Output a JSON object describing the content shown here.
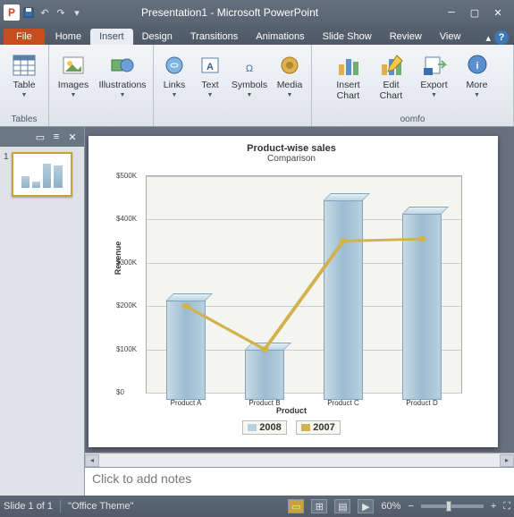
{
  "titlebar": {
    "logo_letter": "P",
    "title": "Presentation1 - Microsoft PowerPoint"
  },
  "tabs": {
    "file": "File",
    "items": [
      "Home",
      "Insert",
      "Design",
      "Transitions",
      "Animations",
      "Slide Show",
      "Review",
      "View"
    ],
    "active_index": 1
  },
  "ribbon": {
    "groups": [
      {
        "label": "Tables",
        "buttons": [
          {
            "name": "table",
            "label": "Table",
            "icon": "table"
          }
        ]
      },
      {
        "label": "",
        "buttons": [
          {
            "name": "images",
            "label": "Images",
            "icon": "image"
          },
          {
            "name": "illustrations",
            "label": "Illustrations",
            "icon": "shapes"
          }
        ]
      },
      {
        "label": "",
        "buttons": [
          {
            "name": "links",
            "label": "Links",
            "icon": "link"
          },
          {
            "name": "text",
            "label": "Text",
            "icon": "text"
          },
          {
            "name": "symbols",
            "label": "Symbols",
            "icon": "omega"
          },
          {
            "name": "media",
            "label": "Media",
            "icon": "media"
          }
        ]
      },
      {
        "label": "oomfo",
        "buttons": [
          {
            "name": "insert-chart",
            "label": "Insert\nChart",
            "icon": "barchart"
          },
          {
            "name": "edit-chart",
            "label": "Edit\nChart",
            "icon": "barchart2"
          },
          {
            "name": "export",
            "label": "Export",
            "icon": "export"
          },
          {
            "name": "more",
            "label": "More",
            "icon": "more"
          }
        ]
      }
    ]
  },
  "slidepanel": {
    "thumb_number": "1"
  },
  "chart_data": {
    "type": "bar",
    "title": "Product-wise sales",
    "subtitle": "Comparison",
    "ylabel": "Revenue",
    "xlabel": "Product",
    "ylim": [
      0,
      500000
    ],
    "yticks": [
      "$0",
      "$100K",
      "$200K",
      "$300K",
      "$400K",
      "$500K"
    ],
    "categories": [
      "Product A",
      "Product B",
      "Product C",
      "Product D"
    ],
    "series": [
      {
        "name": "2008",
        "color": "#b7d2e2",
        "values": [
          230000,
          115000,
          460000,
          430000
        ]
      },
      {
        "name": "2007",
        "color": "#d2b24c",
        "values": [
          200000,
          100000,
          350000,
          355000
        ]
      }
    ]
  },
  "notes": {
    "placeholder": "Click to add notes"
  },
  "statusbar": {
    "slide": "Slide 1 of 1",
    "theme": "\"Office Theme\"",
    "zoom": "60%"
  }
}
